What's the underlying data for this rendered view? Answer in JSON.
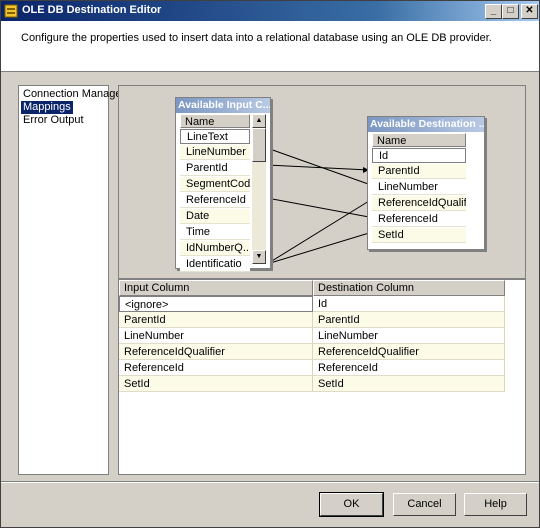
{
  "window": {
    "title": "OLE DB Destination Editor"
  },
  "title_buttons": {
    "minimize": "_",
    "maximize": "□",
    "close": "✕"
  },
  "header": {
    "description": "Configure the properties used to insert data into a relational database using an OLE DB provider."
  },
  "nav": {
    "items": [
      "Connection Manager",
      "Mappings",
      "Error Output"
    ],
    "selected": "Mappings"
  },
  "input_columns_box": {
    "title": "Available Input C...",
    "header": "Name",
    "rows": [
      "LineText",
      "LineNumber",
      "ParentId",
      "SegmentCode",
      "ReferenceId",
      "Date",
      "Time",
      "IdNumberQ...",
      "Identificatio"
    ]
  },
  "destination_columns_box": {
    "title": "Available Destination ...",
    "header": "Name",
    "rows": [
      "Id",
      "ParentId",
      "LineNumber",
      "ReferenceIdQualifier",
      "ReferenceId",
      "SetId"
    ]
  },
  "scroll": {
    "up": "▲",
    "down": "▼"
  },
  "mapping_grid": {
    "columns": [
      "Input Column",
      "Destination Column"
    ],
    "rows": [
      [
        "<ignore>",
        "Id"
      ],
      [
        "ParentId",
        "ParentId"
      ],
      [
        "LineNumber",
        "LineNumber"
      ],
      [
        "ReferenceIdQualifier",
        "ReferenceIdQualifier"
      ],
      [
        "ReferenceId",
        "ReferenceId"
      ],
      [
        "SetId",
        "SetId"
      ]
    ]
  },
  "buttons": {
    "ok": "OK",
    "cancel": "Cancel",
    "help": "Help"
  }
}
